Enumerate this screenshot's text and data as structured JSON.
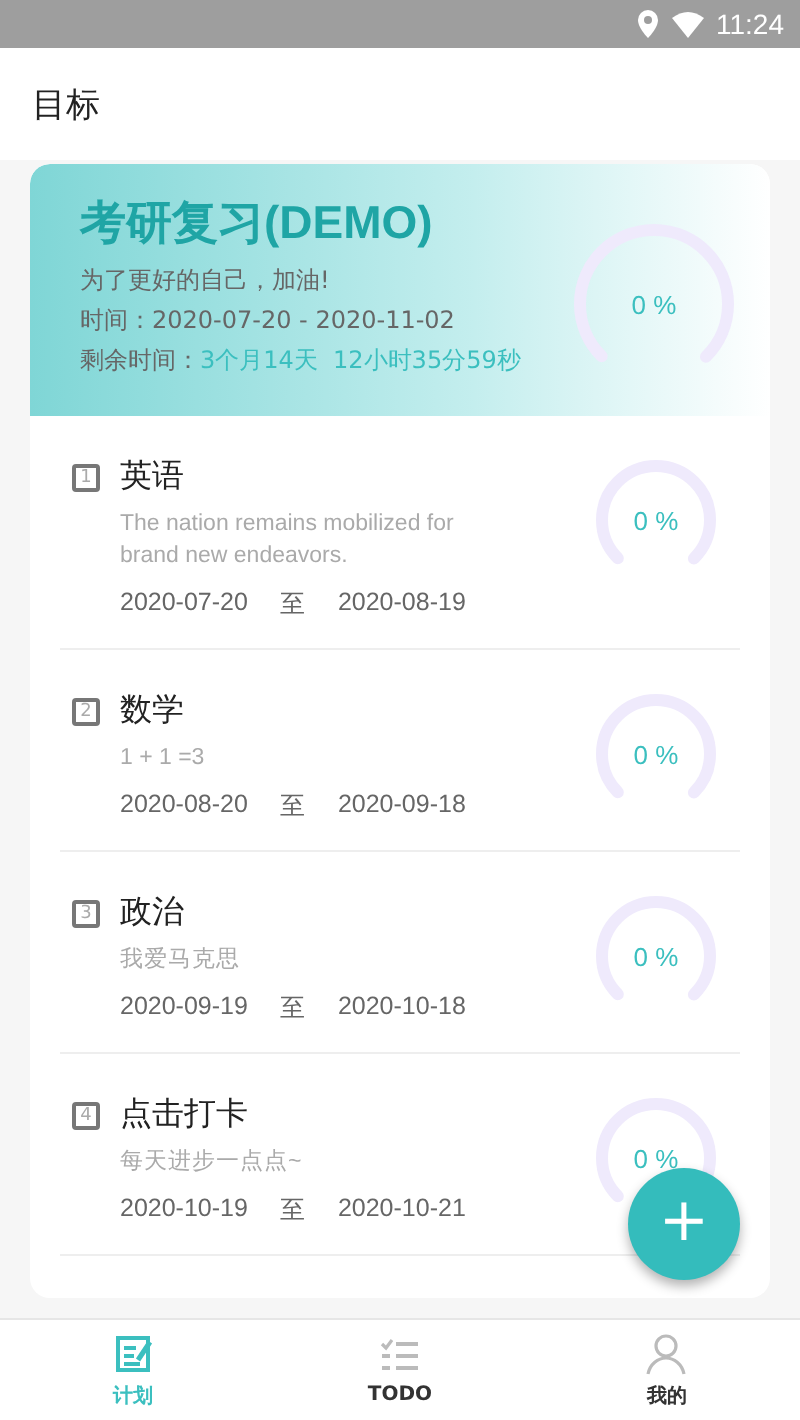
{
  "status_bar": {
    "time": "11:24"
  },
  "app_bar": {
    "title": "目标"
  },
  "goal": {
    "title": "考研复习(DEMO)",
    "motto": "为了更好的自己，加油!",
    "period": "时间：2020-07-20 - 2020-11-02",
    "remaining_label": "剩余时间：",
    "remaining": "3个月14天  12小时35分59秒",
    "percent": "0 %"
  },
  "plans": [
    {
      "index": "1",
      "title": "英语",
      "description": "The nation remains mobilized for brand new endeavors.",
      "start": "2020-07-20",
      "separator": "至",
      "end": "2020-08-19",
      "percent": "0 %"
    },
    {
      "index": "2",
      "title": "数学",
      "description": "1 + 1 =3",
      "start": "2020-08-20",
      "separator": "至",
      "end": "2020-09-18",
      "percent": "0 %"
    },
    {
      "index": "3",
      "title": "政治",
      "description": "我爱马克思",
      "start": "2020-09-19",
      "separator": "至",
      "end": "2020-10-18",
      "percent": "0 %"
    },
    {
      "index": "4",
      "title": "点击打卡",
      "description": "每天进步一点点~",
      "start": "2020-10-19",
      "separator": "至",
      "end": "2020-10-21",
      "percent": "0 %"
    }
  ],
  "fab": {
    "label": "+"
  },
  "tabs": [
    {
      "kind": "plan",
      "label": "计划",
      "selected": true
    },
    {
      "kind": "todo",
      "label": "TODO",
      "selected": false
    },
    {
      "kind": "profile",
      "label": "我的",
      "selected": false
    }
  ]
}
